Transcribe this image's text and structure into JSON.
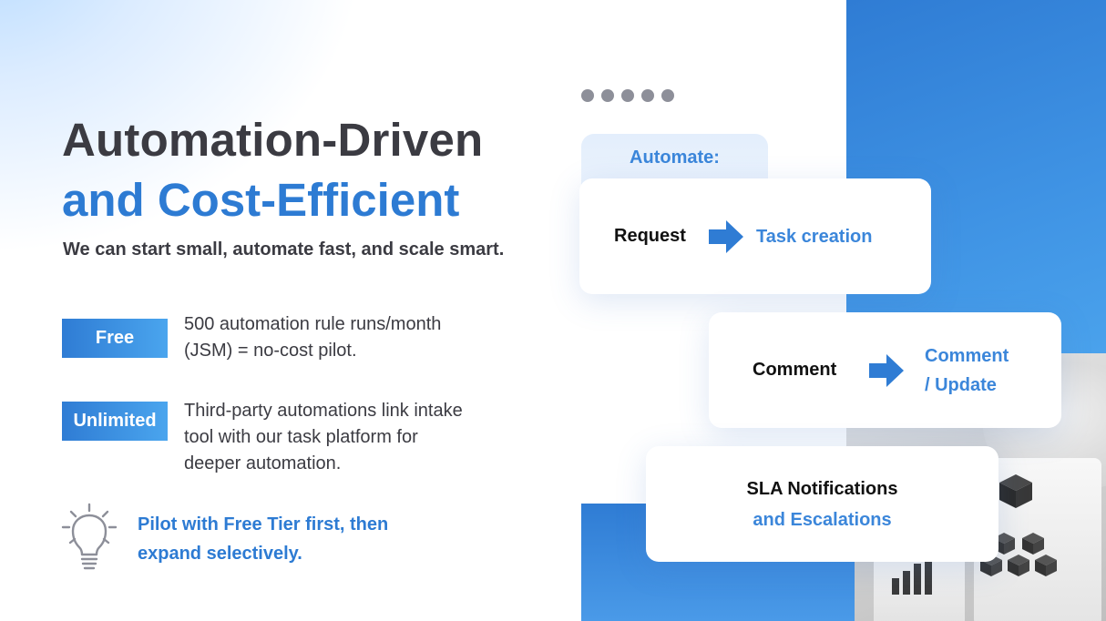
{
  "title": {
    "line1": "Automation-Driven",
    "line2": "and Cost-Efficient",
    "subtitle": "We can start small, automate fast, and scale smart."
  },
  "tiers": [
    {
      "badge": "Free",
      "lines": [
        "500 automation rule runs/month",
        "(JSM) = no-cost pilot."
      ]
    },
    {
      "badge": "Unlimited",
      "lines": [
        "Third-party automations link intake",
        "tool with our task platform for",
        "deeper automation."
      ]
    }
  ],
  "tip": {
    "icon": "lightbulb-icon",
    "lines": [
      "Pilot with Free Tier first, then",
      "expand selectively."
    ]
  },
  "automate": {
    "label": "Automate:",
    "flows": [
      {
        "from": "Request",
        "to": [
          "Task creation"
        ]
      },
      {
        "from": "Comment",
        "to": [
          "Comment",
          "/ Update"
        ]
      },
      {
        "from": "SLA Notifications",
        "to": [
          "and Escalations"
        ]
      }
    ]
  },
  "colors": {
    "accent": "#2d7bd3",
    "text_dark": "#3b3b42",
    "dots": "#8d8f99"
  }
}
